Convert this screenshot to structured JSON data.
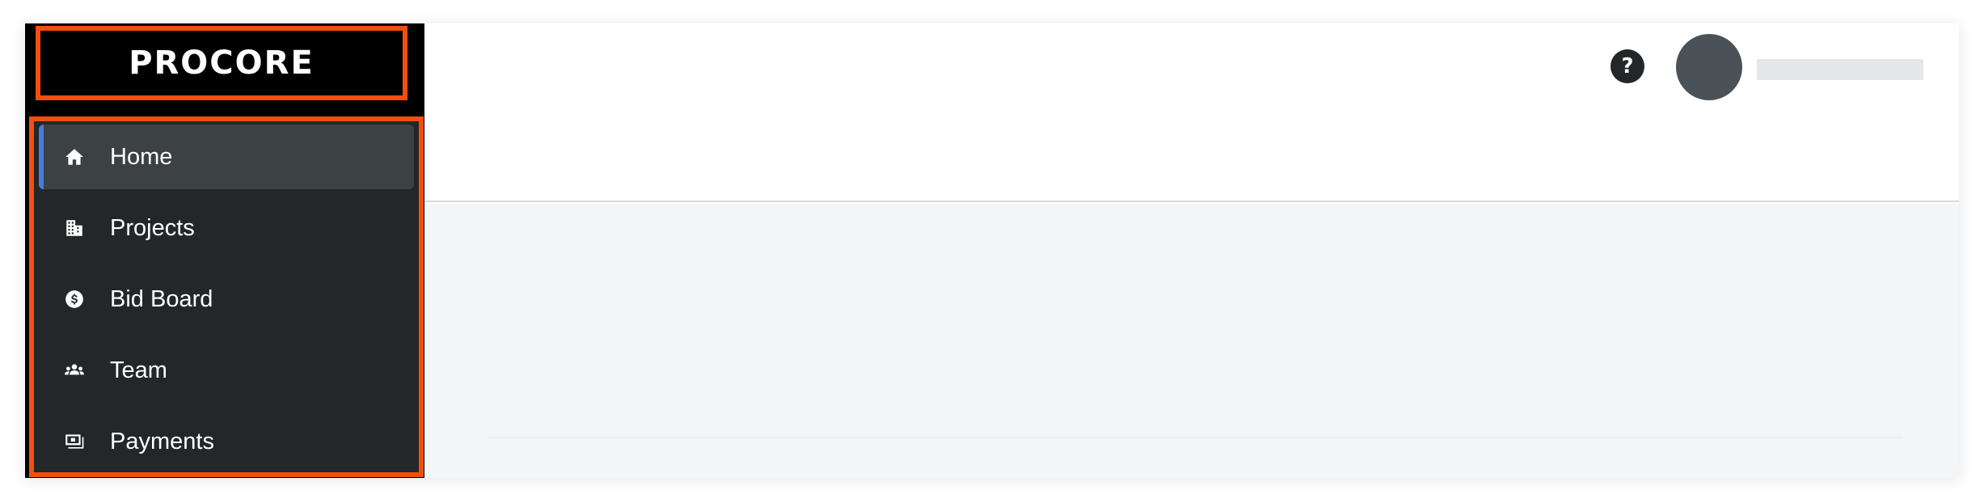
{
  "brand": {
    "logo_text": "PROCORE",
    "accent_color": "#f44e0d",
    "active_indicator_color": "#4a7ad8"
  },
  "sidebar": {
    "items": [
      {
        "label": "Home",
        "icon": "home-icon",
        "active": true
      },
      {
        "label": "Projects",
        "icon": "building-icon",
        "active": false
      },
      {
        "label": "Bid Board",
        "icon": "dollar-circle-icon",
        "active": false
      },
      {
        "label": "Team",
        "icon": "team-icon",
        "active": false
      },
      {
        "label": "Payments",
        "icon": "payments-icon",
        "active": false
      }
    ]
  },
  "header": {
    "help_icon_text": "?"
  }
}
